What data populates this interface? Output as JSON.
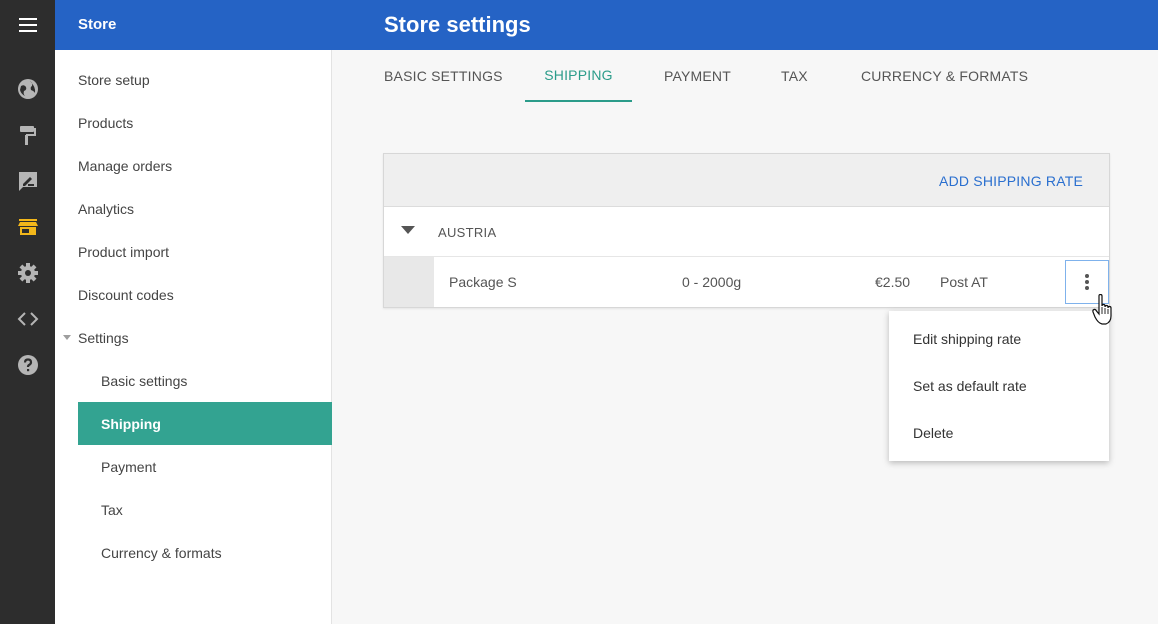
{
  "header": {
    "store_title": "Store",
    "page_title": "Store settings"
  },
  "rail": {
    "icons": [
      "globe-icon",
      "paint-roller-icon",
      "edit-icon",
      "store-icon",
      "gear-icon",
      "code-icon",
      "help-icon"
    ],
    "active_icon": "store-icon",
    "active_color": "#f3b71a",
    "icon_color": "#b5b5b5"
  },
  "sidebar": {
    "items": [
      {
        "label": "Store setup"
      },
      {
        "label": "Products"
      },
      {
        "label": "Manage orders"
      },
      {
        "label": "Analytics"
      },
      {
        "label": "Product import"
      },
      {
        "label": "Discount codes"
      },
      {
        "label": "Settings"
      }
    ],
    "sub_items": [
      {
        "label": "Basic settings"
      },
      {
        "label": "Shipping"
      },
      {
        "label": "Payment"
      },
      {
        "label": "Tax"
      },
      {
        "label": "Currency & formats"
      }
    ],
    "active_sub": "Shipping",
    "accent": "#33a391"
  },
  "tabs": [
    {
      "label": "BASIC SETTINGS"
    },
    {
      "label": "SHIPPING"
    },
    {
      "label": "PAYMENT"
    },
    {
      "label": "TAX"
    },
    {
      "label": "CURRENCY & FORMATS"
    }
  ],
  "active_tab": "SHIPPING",
  "shipping": {
    "add_rate_label": "ADD SHIPPING RATE",
    "group": {
      "name": "AUSTRIA"
    },
    "rate": {
      "name": "Package S",
      "weight": "0 - 2000g",
      "price": "€2.50",
      "carrier": "Post AT"
    }
  },
  "context_menu": {
    "items": [
      {
        "label": "Edit shipping rate"
      },
      {
        "label": "Set as default rate"
      },
      {
        "label": "Delete"
      }
    ]
  },
  "colors": {
    "header_blue": "#2563c5",
    "dark_rail": "#2d2d2d",
    "link_blue": "#2a6fcf",
    "tab_accent": "#2b9c8a"
  }
}
